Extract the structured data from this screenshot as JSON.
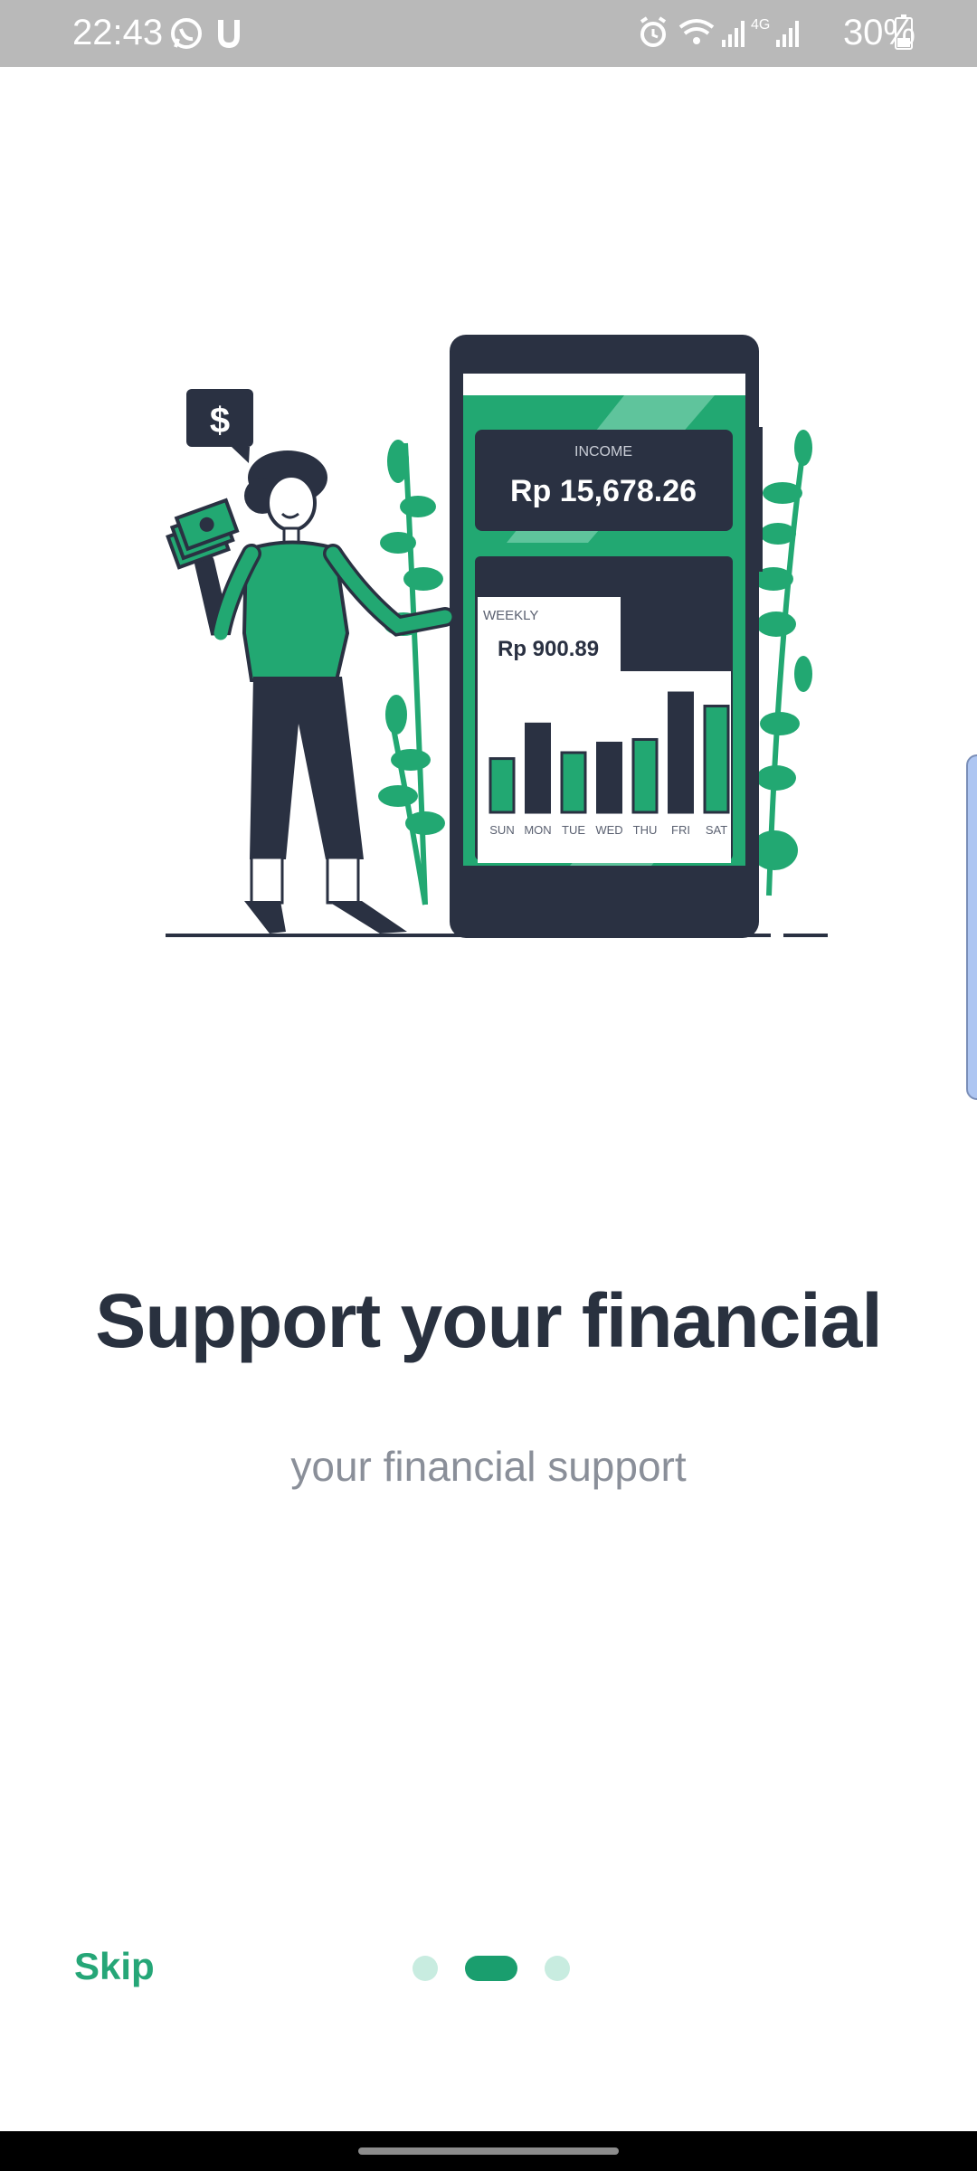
{
  "status": {
    "time": "22:43",
    "battery": "30%",
    "network": "4G",
    "left_icons": [
      "whatsapp-icon",
      "u-icon"
    ],
    "right_icons": [
      "alarm-icon",
      "wifi-icon",
      "signal-icon",
      "signal-icon",
      "battery-icon"
    ]
  },
  "illustration": {
    "speech_symbol": "$",
    "income_label": "INCOME",
    "income_value": "Rp 15,678.26",
    "weekly_label": "WEEKLY",
    "weekly_value": "Rp  900.89",
    "days": [
      "SUN",
      "MON",
      "TUE",
      "WED",
      "THU",
      "FRI",
      "SAT"
    ],
    "bar_levels": [
      0.45,
      0.74,
      0.5,
      0.58,
      0.61,
      1.0,
      0.89
    ],
    "colors": {
      "green": "#22a872",
      "dark": "#2a3142"
    }
  },
  "content": {
    "title": "Support your financial",
    "subtitle": "your financial support"
  },
  "footer": {
    "skip_label": "Skip",
    "page_indicator": {
      "count": 3,
      "active": 2
    }
  },
  "colors": {
    "accent": "#1a9e6e",
    "title": "#29313f",
    "subtitle": "#8a8f99"
  }
}
